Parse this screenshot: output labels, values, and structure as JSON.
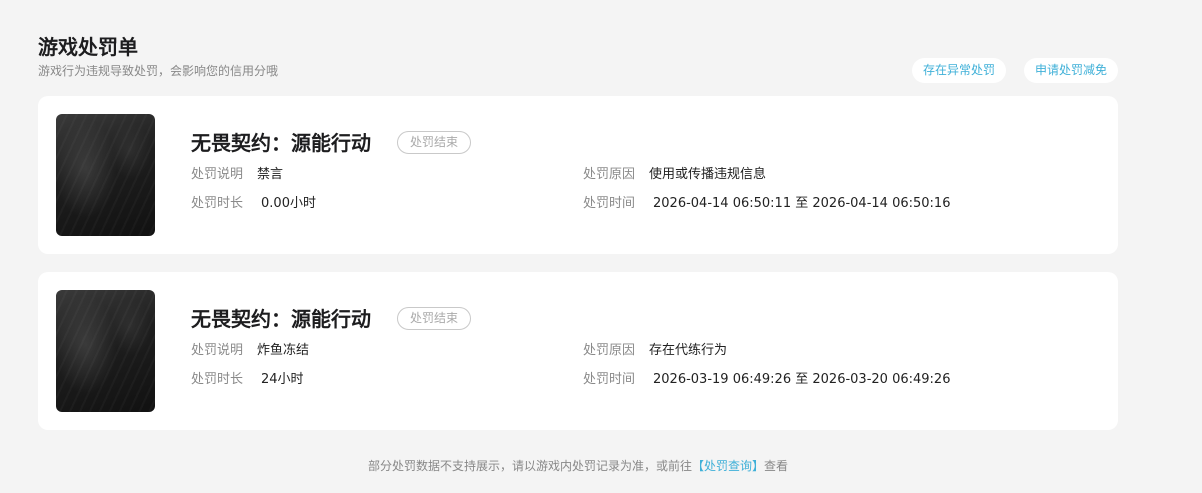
{
  "header": {
    "title": "游戏处罚单",
    "subtitle": "游戏行为违规导致处罚，会影响您的信用分哦",
    "actions": {
      "abnormal_label": "存在异常处罚",
      "reduction_label": "申请处罚减免"
    }
  },
  "labels": {
    "description": "处罚说明",
    "reason": "处罚原因",
    "duration": "处罚时长",
    "time": "处罚时间",
    "to": "至"
  },
  "penalties": [
    {
      "game": "无畏契约：源能行动",
      "status": "处罚结束",
      "description": "禁言",
      "reason": "使用或传播违规信息",
      "duration": "0.00小时",
      "start": "2026-04-14 06:50:11",
      "end": "2026-04-14 06:50:16"
    },
    {
      "game": "无畏契约：源能行动",
      "status": "处罚结束",
      "description": "炸鱼冻结",
      "reason": "存在代练行为",
      "duration": "24小时",
      "start": "2026-03-19 06:49:26",
      "end": "2026-03-20 06:49:26"
    }
  ],
  "footer": {
    "text_before": "部分处罚数据不支持展示，请以游戏内处罚记录为准，或前往",
    "link": "【处罚查询】",
    "text_after": "查看"
  },
  "colors": {
    "accent": "#3fb0d8",
    "background": "#f4f4f4"
  }
}
